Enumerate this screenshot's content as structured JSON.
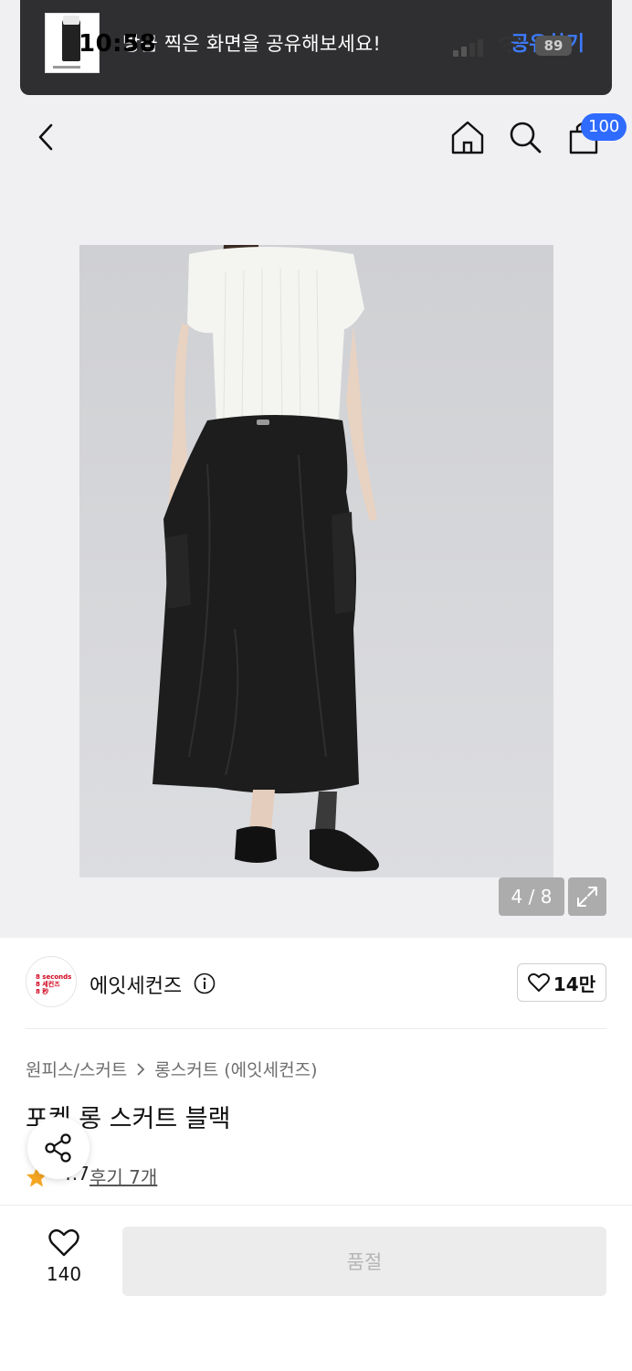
{
  "status_bar": {
    "time": "10:58",
    "battery": "89"
  },
  "toast": {
    "message": "방금 찍은 화면을 공유해보세요!",
    "action_label": "공유하기"
  },
  "nav": {
    "cart_badge": "100",
    "icons": [
      "back-icon",
      "home-icon",
      "search-icon",
      "cart-icon"
    ]
  },
  "gallery": {
    "counter": "4 / 8"
  },
  "brand": {
    "name": "에잇세컨즈",
    "logo_lines": [
      "8 seconds",
      "8 세컨즈",
      "8 秒"
    ],
    "like_count": "14만"
  },
  "product": {
    "breadcrumb": [
      "원피스/스커트",
      "롱스커트 (에잇세컨즈)"
    ],
    "title": "포켓 롱 스커트 블랙",
    "rating": "4.7",
    "review_label": "후기 7개"
  },
  "bottom_bar": {
    "wish_count": "140",
    "soldout_label": "품절"
  },
  "colors": {
    "accent": "#2f6bff",
    "star": "#f5a623",
    "toast_bg": "#2f2f31"
  }
}
